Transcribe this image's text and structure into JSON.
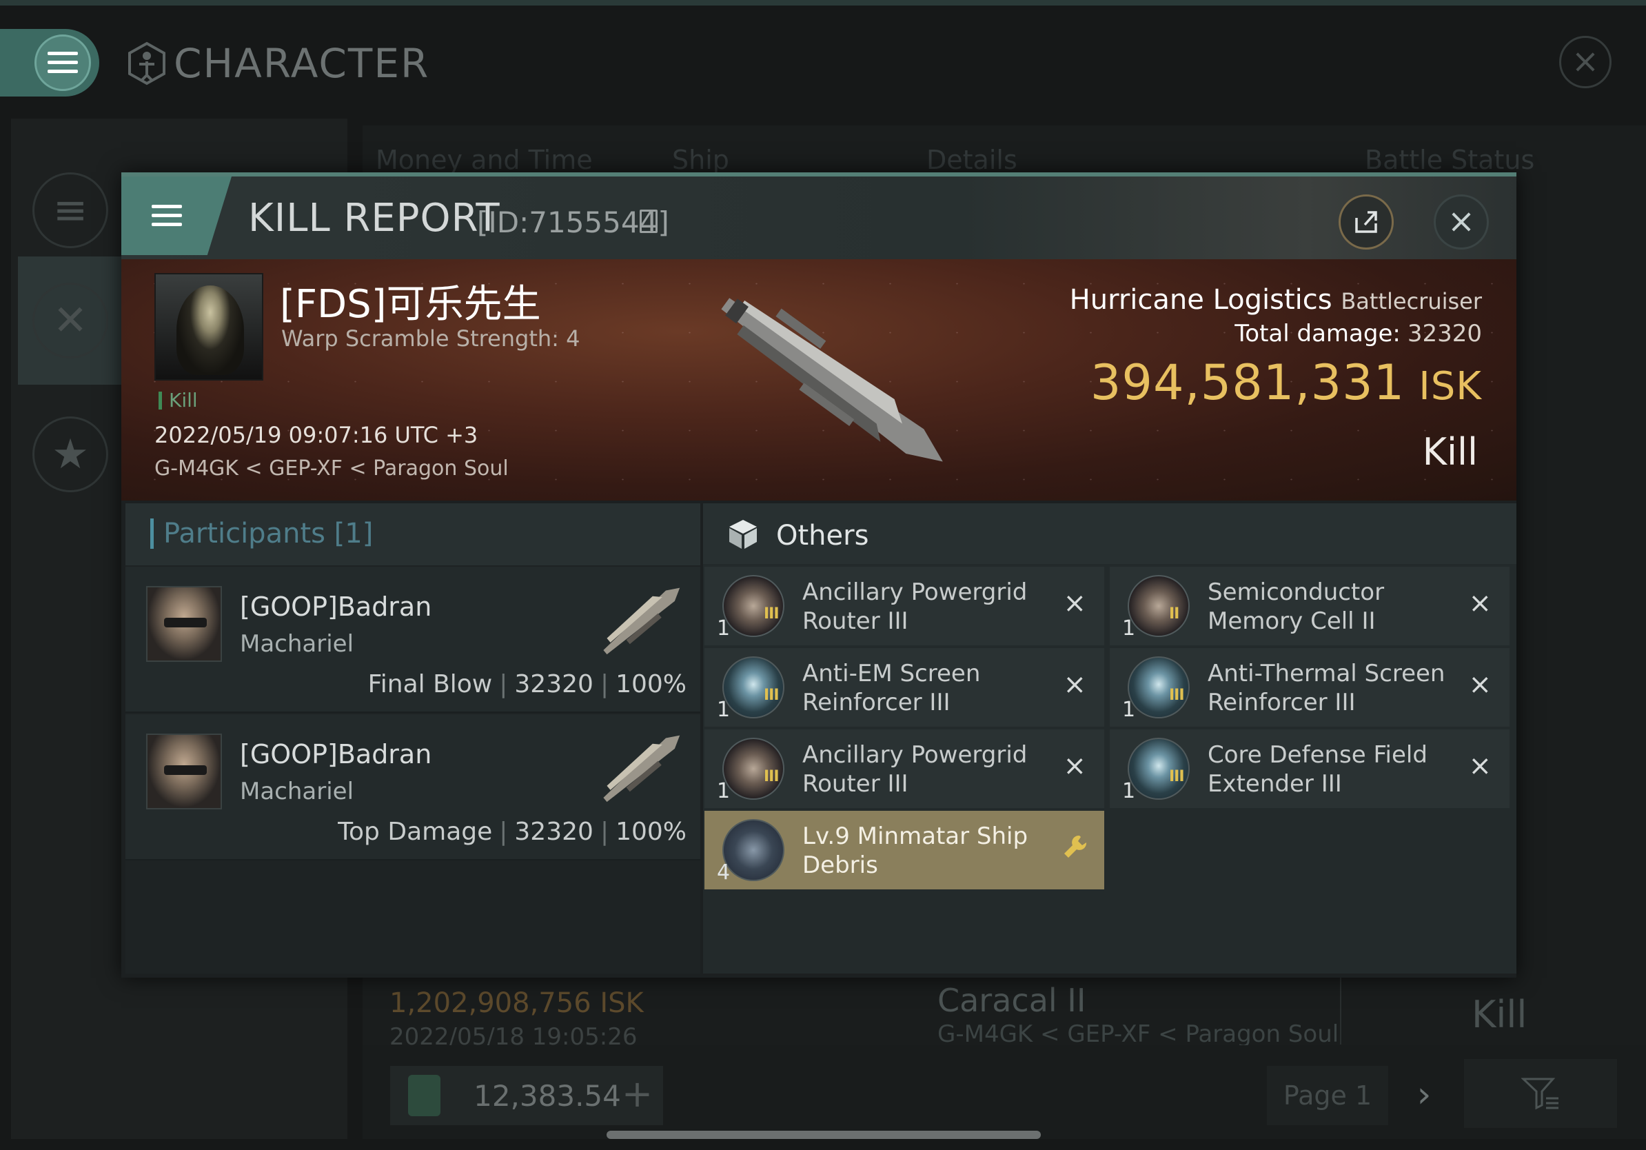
{
  "background": {
    "title": "CHARACTER",
    "table_headers": [
      "Money and Time",
      "Ship",
      "Details",
      "Battle Status"
    ],
    "row": {
      "isk": "1,202,908,756  ISK",
      "date": "2022/05/18  19:05:26",
      "ship": "Caracal II",
      "location": "G-M4GK < GEP-XF < Paragon Soul",
      "status": "Kill"
    },
    "wallet_value": "12,383.54",
    "page": "Page 1"
  },
  "modal": {
    "title": "KILL REPORT",
    "id": "[ID:7155544]",
    "victim": {
      "name": "[FDS]可乐先生",
      "scramble": "Warp Scramble Strength: 4",
      "tag": "Kill",
      "datetime": "2022/05/19 09:07:16 UTC +3",
      "location": "G-M4GK < GEP-XF < Paragon Soul"
    },
    "ship": {
      "name": "Hurricane Logistics",
      "class": "Battlecruiser",
      "damage_label": "Total damage:",
      "damage_value": "32320",
      "isk_value": "394,581,331",
      "isk_unit": "ISK",
      "result": "Kill"
    },
    "participants_label": "Participants [1]",
    "participants": [
      {
        "name": "[GOOP]Badran",
        "ship": "Machariel",
        "role": "Final Blow",
        "damage": "32320",
        "percent": "100%"
      },
      {
        "name": "[GOOP]Badran",
        "ship": "Machariel",
        "role": "Top Damage",
        "damage": "32320",
        "percent": "100%"
      }
    ],
    "others_label": "Others",
    "items": [
      {
        "name": "Ancillary Powergrid Router III",
        "qty": "1",
        "tier": "III",
        "icon": "cylinder",
        "action": "×"
      },
      {
        "name": "Semiconductor Memory Cell II",
        "qty": "1",
        "tier": "II",
        "icon": "cylinder",
        "action": "×"
      },
      {
        "name": "Anti-EM Screen Reinforcer III",
        "qty": "1",
        "tier": "III",
        "icon": "shield",
        "action": "×"
      },
      {
        "name": "Anti-Thermal Screen Reinforcer III",
        "qty": "1",
        "tier": "III",
        "icon": "shield",
        "action": "×"
      },
      {
        "name": "Ancillary Powergrid Router III",
        "qty": "1",
        "tier": "III",
        "icon": "cylinder",
        "action": "×"
      },
      {
        "name": "Core Defense Field Extender III",
        "qty": "1",
        "tier": "III",
        "icon": "shield",
        "action": "×"
      },
      {
        "name": "Lv.9 Minmatar Ship Debris",
        "qty": "4",
        "tier": "",
        "icon": "debris",
        "action": "wrench"
      }
    ]
  }
}
